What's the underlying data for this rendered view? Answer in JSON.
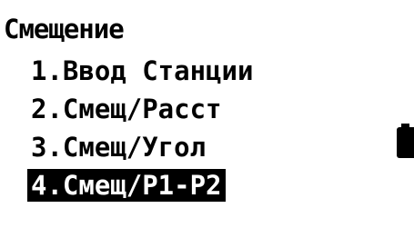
{
  "screen": {
    "title": "Смещение",
    "menu": [
      {
        "label": "1.Ввод Станции",
        "selected": false
      },
      {
        "label": "2.Смещ/Расст",
        "selected": false
      },
      {
        "label": "3.Смещ/Угол",
        "selected": false
      },
      {
        "label": "4.Смещ/P1-P2",
        "selected": true
      }
    ],
    "indicators": {
      "battery_icon": "battery-icon"
    }
  },
  "colors": {
    "background": "#ffffff",
    "foreground": "#000000",
    "highlight": "#000000",
    "highlight_text": "#ffffff"
  }
}
